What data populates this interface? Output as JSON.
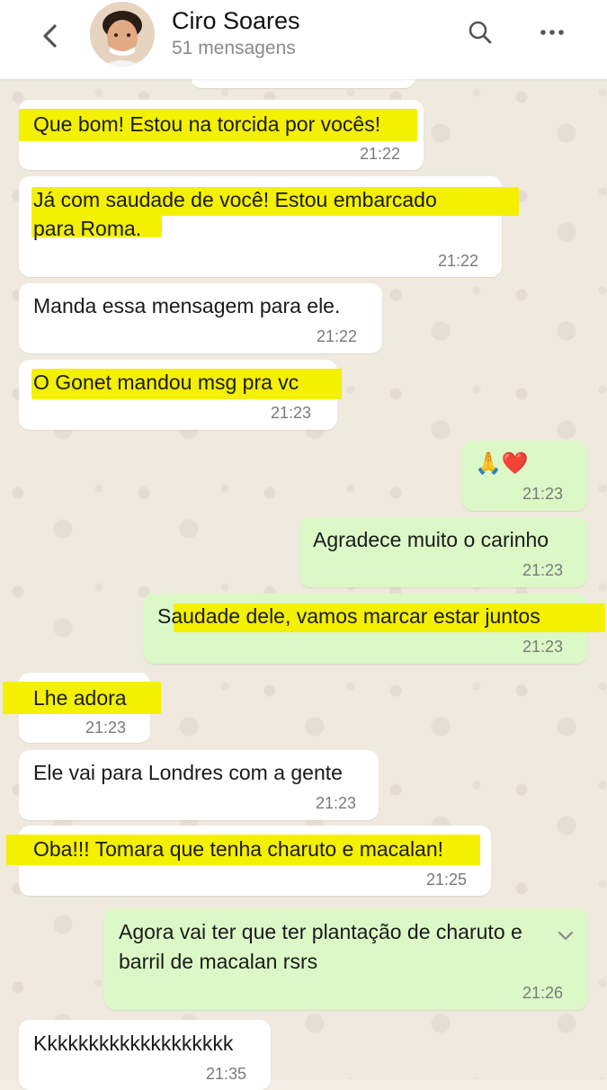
{
  "header": {
    "contact_name": "Ciro Soares",
    "subtitle": "51 mensagens",
    "icons": [
      "chevron-left-icon",
      "avatar",
      "search-icon",
      "more-icon"
    ]
  },
  "colors": {
    "incoming_bubble": "#ffffff",
    "outgoing_bubble": "#dcf8c6",
    "highlight": "#f3f000",
    "wallpaper": "#efe9de"
  },
  "messages": [
    {
      "dir": "in",
      "lines": [
        "Que bom! Estou na torcida por vocês!"
      ],
      "time": "21:22"
    },
    {
      "dir": "in",
      "lines": [
        "Já com saudade de você! Estou embarcado",
        "para Roma."
      ],
      "time": "21:22"
    },
    {
      "dir": "in",
      "lines": [
        "Manda essa mensagem para ele."
      ],
      "time": "21:22"
    },
    {
      "dir": "in",
      "lines": [
        "O Gonet mandou msg pra vc"
      ],
      "time": "21:23"
    },
    {
      "dir": "out",
      "lines": [
        "🙏❤️"
      ],
      "time": "21:23"
    },
    {
      "dir": "out",
      "lines": [
        "Agradece muito o carinho"
      ],
      "time": "21:23"
    },
    {
      "dir": "out",
      "lines": [
        "Saudade dele, vamos marcar estar juntos"
      ],
      "time": "21:23"
    },
    {
      "dir": "in",
      "lines": [
        "Lhe adora"
      ],
      "time": "21:23"
    },
    {
      "dir": "in",
      "lines": [
        "Ele vai para Londres com a gente"
      ],
      "time": "21:23"
    },
    {
      "dir": "in",
      "lines": [
        "Oba!!! Tomara que tenha charuto e macalan!"
      ],
      "time": "21:25"
    },
    {
      "dir": "out",
      "lines": [
        "Agora vai ter que ter plantação de charuto e",
        "barril de macalan rsrs"
      ],
      "time": "21:26"
    },
    {
      "dir": "in",
      "lines": [
        "Kkkkkkkkkkkkkkkkkkk"
      ],
      "time": "21:35"
    }
  ]
}
